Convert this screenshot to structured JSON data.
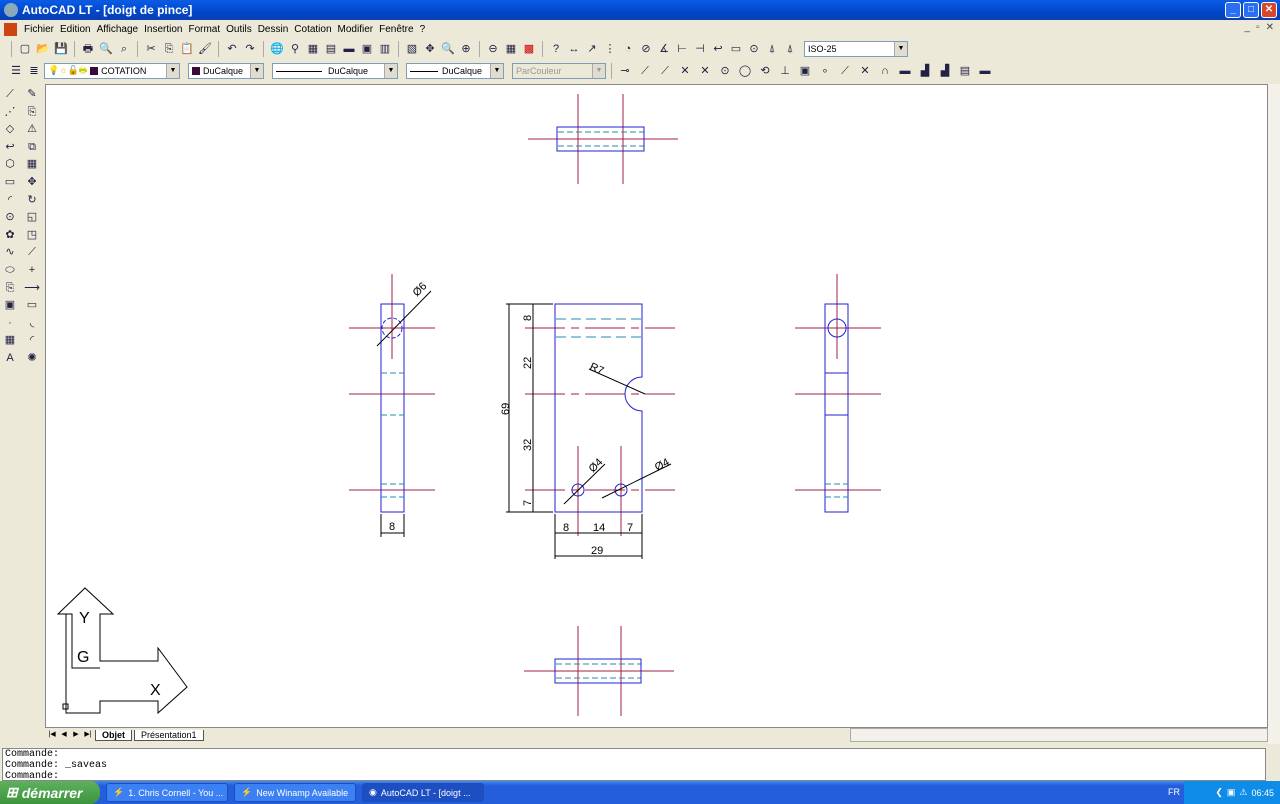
{
  "window": {
    "title": "AutoCAD LT - [doigt de pince]"
  },
  "menu": [
    "Fichier",
    "Edition",
    "Affichage",
    "Insertion",
    "Format",
    "Outils",
    "Dessin",
    "Cotation",
    "Modifier",
    "Fenêtre",
    "?"
  ],
  "toolbar1": {
    "icons": [
      "new-icon",
      "open-icon",
      "save-icon",
      "print-icon",
      "preview-icon",
      "publish-icon",
      "cut-icon",
      "copy-icon",
      "paste-icon",
      "match-icon",
      "undo-icon",
      "redo-icon",
      "globe-icon",
      "snap-icon",
      "block-icon",
      "hatch-icon",
      "layer-icon",
      "properties-icon",
      "design-center-icon",
      "pan-icon",
      "zoom-realtime-icon",
      "zoom-window-icon",
      "zoom-prev-icon",
      "table-icon",
      "palette-icon",
      "help-icon",
      "dim-linear-icon",
      "dim-aligned-icon",
      "dim-ordinate-icon",
      "dim-radius-icon",
      "dim-diameter-icon",
      "dim-angular-icon",
      "dim-baseline-icon",
      "dim-continue-icon",
      "leader-icon",
      "tolerance-icon",
      "center-mark-icon",
      "dim-edit-icon",
      "dim-text-edit-icon",
      "dim-update-icon"
    ],
    "dimstyle": "ISO-25"
  },
  "toolbar2": {
    "layer": "COTATION",
    "color": "DuCalque",
    "linetype": "DuCalque",
    "lineweight": "DuCalque",
    "plotstyle": "ParCouleur"
  },
  "drawing": {
    "dims": {
      "d69": "69",
      "d8v": "8",
      "d22": "22",
      "d32": "32",
      "d7v": "7",
      "r7": "R7",
      "phi4a": "Ø4",
      "phi4b": "Ø4",
      "d8h": "8",
      "d14": "14",
      "d7h": "7",
      "d29": "29",
      "phi6": "Ø6",
      "side8": "8"
    },
    "ucs": {
      "x": "X",
      "y": "Y"
    }
  },
  "tabs": [
    "Objet",
    "Présentation1"
  ],
  "command": [
    "Commande:",
    "Commande: _saveas",
    "Commande:"
  ],
  "taskbar": {
    "start": "démarrer",
    "tasks": [
      "1. Chris Cornell - You ...",
      "New Winamp Available",
      "AutoCAD LT - [doigt ..."
    ],
    "lang": "FR",
    "clock": "06:45"
  },
  "colors": {
    "object": "#2020d0",
    "center": "#a0204a",
    "hidden": "#2a8ab0",
    "dim": "#000000"
  }
}
